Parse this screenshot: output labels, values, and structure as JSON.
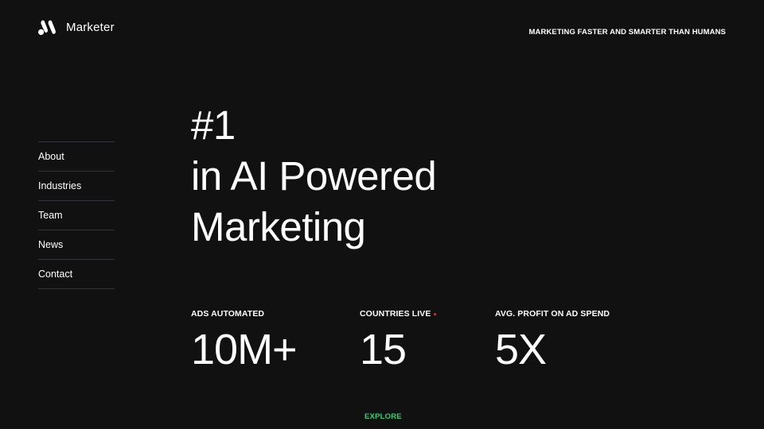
{
  "header": {
    "brand": "Marketer",
    "tagline": "MARKETING FASTER AND SMARTER THAN HUMANS"
  },
  "nav": {
    "items": [
      {
        "label": "About"
      },
      {
        "label": "Industries"
      },
      {
        "label": "Team"
      },
      {
        "label": "News"
      },
      {
        "label": "Contact"
      }
    ]
  },
  "hero": {
    "line1": "#1",
    "line2": "in AI Powered",
    "line3": "Marketing"
  },
  "stats": [
    {
      "label": "ADS AUTOMATED",
      "value": "10M+"
    },
    {
      "label": "COUNTRIES LIVE",
      "value": "15",
      "live_indicator_color": "#e2323c"
    },
    {
      "label": "AVG. PROFIT ON AD SPEND",
      "value": "5X"
    }
  ],
  "cta": {
    "label": "EXPLORE",
    "color": "#2fd07a"
  },
  "colors": {
    "background": "#121112",
    "text": "#ffffff",
    "divider": "#34323a"
  },
  "icons": {
    "logo": "marketer-logo-icon"
  }
}
